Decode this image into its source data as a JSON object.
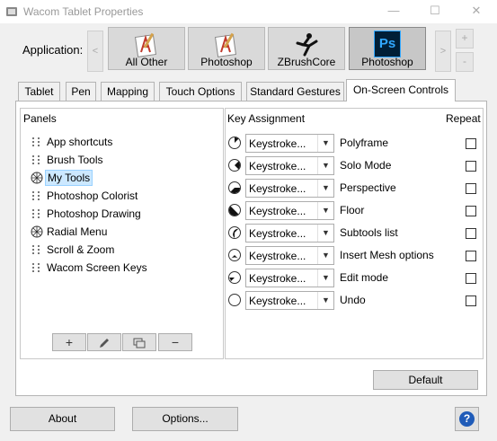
{
  "window": {
    "title": "Wacom Tablet Properties",
    "controls": [
      "—",
      "☐",
      "✕"
    ]
  },
  "application": {
    "label": "Application:",
    "scroll_left": "<",
    "scroll_right": ">",
    "add": "+",
    "remove": "-",
    "apps": [
      {
        "label": "All Other",
        "icon": "all-other-app-icon"
      },
      {
        "label": "Photoshop",
        "icon": "photoshop-legacy-icon"
      },
      {
        "label": "ZBrushCore",
        "icon": "zbrush-icon"
      },
      {
        "label": "Photoshop",
        "icon": "photoshop-ps-icon",
        "icon_text": "Ps"
      }
    ],
    "selected_index": 3
  },
  "tabs": [
    {
      "label": "Tablet"
    },
    {
      "label": "Pen"
    },
    {
      "label": "Mapping"
    },
    {
      "label": "Touch Options"
    },
    {
      "label": "Standard Gestures"
    },
    {
      "label": "On-Screen Controls",
      "active": true
    }
  ],
  "panels": {
    "title": "Panels",
    "items": [
      {
        "label": "App shortcuts",
        "icon": "grid-icon"
      },
      {
        "label": "Brush Tools",
        "icon": "grid-icon"
      },
      {
        "label": "My Tools",
        "icon": "radial-icon",
        "selected": true
      },
      {
        "label": "Photoshop Colorist",
        "icon": "grid-icon"
      },
      {
        "label": "Photoshop Drawing",
        "icon": "grid-icon"
      },
      {
        "label": "Radial Menu",
        "icon": "radial-icon"
      },
      {
        "label": "Scroll & Zoom",
        "icon": "grid-icon"
      },
      {
        "label": "Wacom Screen Keys",
        "icon": "grid-icon"
      }
    ],
    "buttons": {
      "add": "+",
      "edit": "✎",
      "duplicate": "⧉",
      "delete": "−"
    }
  },
  "key_assignment": {
    "title": "Key Assignment",
    "repeat_label": "Repeat",
    "rows": [
      {
        "action": "Keystroke...",
        "name": "Polyframe",
        "repeat": false
      },
      {
        "action": "Keystroke...",
        "name": "Solo Mode",
        "repeat": false
      },
      {
        "action": "Keystroke...",
        "name": "Perspective",
        "repeat": false
      },
      {
        "action": "Keystroke...",
        "name": "Floor",
        "repeat": false
      },
      {
        "action": "Keystroke...",
        "name": "Subtools list",
        "repeat": false
      },
      {
        "action": "Keystroke...",
        "name": "Insert Mesh options",
        "repeat": false
      },
      {
        "action": "Keystroke...",
        "name": "Edit mode",
        "repeat": false
      },
      {
        "action": "Keystroke...",
        "name": "Undo",
        "repeat": false
      }
    ],
    "default_button": "Default"
  },
  "footer": {
    "about": "About",
    "options": "Options...",
    "help": "?"
  },
  "colors": {
    "selection_bg": "#cce8ff",
    "selection_border": "#99d1ff",
    "ps_blue": "#31a8ff",
    "ps_dark": "#001e36",
    "help_blue": "#1f5bb8"
  }
}
